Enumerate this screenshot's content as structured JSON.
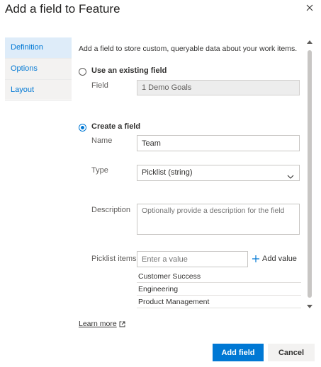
{
  "dialog": {
    "title": "Add a field to Feature"
  },
  "sidebar": {
    "items": [
      {
        "label": "Definition",
        "active": true
      },
      {
        "label": "Options"
      },
      {
        "label": "Layout"
      }
    ]
  },
  "content": {
    "description": "Add a field to store custom, queryable data about your work items.",
    "existing": {
      "label": "Use an existing field",
      "selected": false,
      "field_label": "Field",
      "field_value": "1 Demo Goals"
    },
    "create": {
      "label": "Create a field",
      "selected": true,
      "name_label": "Name",
      "name_value": "Team",
      "type_label": "Type",
      "type_value": "Picklist (string)",
      "description_label": "Description",
      "description_placeholder": "Optionally provide a description for the field",
      "picklist_label": "Picklist items",
      "picklist_placeholder": "Enter a value",
      "add_value_label": "Add value",
      "picklist_items": [
        "Customer Success",
        "Engineering",
        "Product Management"
      ]
    }
  },
  "footer": {
    "learn_more": "Learn more",
    "add_button": "Add field",
    "cancel_button": "Cancel"
  },
  "colors": {
    "accent": "#0078d4",
    "sidebar_active": "#deecf9"
  }
}
